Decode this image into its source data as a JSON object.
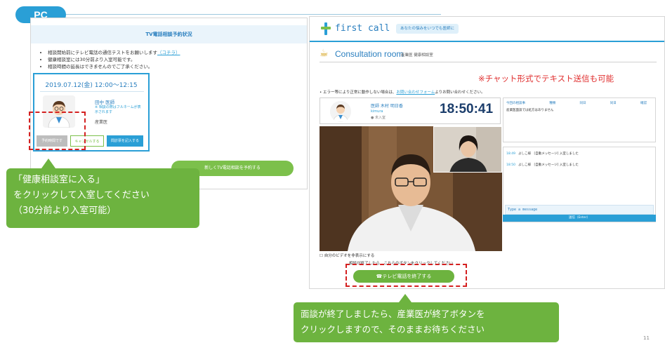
{
  "pc_tab": "PC",
  "left": {
    "header": "TV電話相談予約状況",
    "notes": [
      "相談開始前にテレビ電話の通信テストをお願いします",
      "健康相談室には30分前より入室可能です。",
      "相談時間の延長はできませんのでご了承ください。"
    ],
    "notes_link": "（コチラ）",
    "appointment": {
      "date": "2019.07.12(金) 12:00〜12:15",
      "doctor_name": "田中 医師",
      "doctor_note": "※ 相談の際はフルネームが表示されます",
      "doctor_role": "産業医"
    },
    "buttons": {
      "enter": "予約時間です",
      "cancel": "キャンセルする",
      "questionnaire": "問診票を記入する"
    },
    "new_reservation": "新しくTV電話相談を予約する"
  },
  "callout_left": {
    "line1": "「健康相談室に入る」",
    "line2": "をクリックして入室してください",
    "line3": "（30分前より入室可能）"
  },
  "right": {
    "logo_text": "first call",
    "tagline": "あなたの悩みをいつでも医師に",
    "room_title": "Consultation room",
    "room_sub": "産業医 健康相談室",
    "red_note": "※チャット形式でテキスト送信も可能",
    "error_note": "エラー等により正常に動作しない場合は、",
    "error_link": "お問い合わせフォーム",
    "error_tail": "よりお問い合わせください。",
    "doctor": {
      "name": "医師 木村 明日香",
      "small": "kimura",
      "role": "● 未入室"
    },
    "timer": "18:50:41",
    "panel1": {
      "headers": [
        "今回の相談事",
        "種類",
        "同日",
        "同日",
        "確認"
      ],
      "text": "産業医面談では処方はありません"
    },
    "chat": [
      {
        "time": "18:49",
        "text": "よしこ様　[自動メッセージ] 入室しました"
      },
      {
        "time": "18:50",
        "text": "よしこ様　[自動メッセージ] 入室しました"
      }
    ],
    "chat_placeholder": "Type a message",
    "chat_send": "送信（Enter）",
    "video_caption": "自分のビデオを非表示にする",
    "video_caption2": "相談が終了したら、こちらのボタンをクリックしてください",
    "end_button": "テレビ電話を終了する"
  },
  "callout_right": {
    "line1": "面談が終了しましたら、産業医が終了ボタンを",
    "line2": "クリックしますので、そのままお待ちください"
  },
  "page_number": "11"
}
